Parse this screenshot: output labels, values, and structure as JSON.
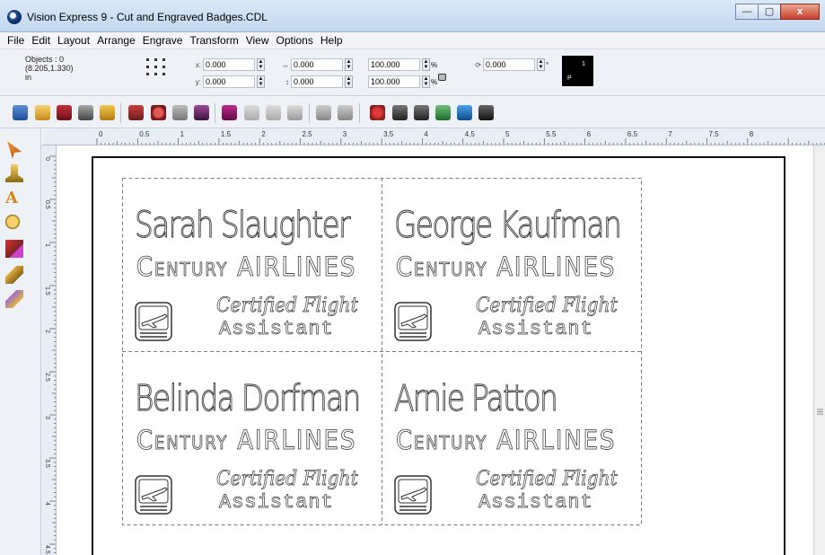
{
  "window": {
    "title": "Vision Express 9 - Cut and Engraved Badges.CDL",
    "buttons": {
      "minimize": "—",
      "maximize": "▢",
      "close": "x"
    }
  },
  "menu": [
    "File",
    "Edit",
    "Layout",
    "Arrange",
    "Engrave",
    "Transform",
    "View",
    "Options",
    "Help"
  ],
  "properties": {
    "objects_label": "Objects : 0",
    "position": "(8.205,1.330)",
    "units": "in",
    "x_label": "x:",
    "x": "0.000",
    "y_label": "y:",
    "y": "0.000",
    "width": "0.000",
    "height": "0.000",
    "scale_x": "100.000",
    "scale_y": "100.000",
    "rotation": "0.000",
    "degree": "°",
    "pct_symbol": "%",
    "swatch_number": "1",
    "swatch_letter": "P"
  },
  "ruler": {
    "horizontal": [
      "0",
      "0.5",
      "1",
      "1.5",
      "2",
      "2.5",
      "3",
      "3.5",
      "4",
      "4.5",
      "5",
      "5.5",
      "6",
      "6.5",
      "7",
      "7.5",
      "8"
    ],
    "vertical": [
      "0",
      "0.5",
      "1",
      "1.5",
      "2",
      "2.5",
      "3",
      "3.5",
      "4",
      "4.5"
    ]
  },
  "badges": [
    {
      "name": "Sarah Slaughter",
      "company": "Century AIRLINES",
      "title_line1": "Certified Flight",
      "title_line2": "Assistant"
    },
    {
      "name": "George Kaufman",
      "company": "Century AIRLINES",
      "title_line1": "Certified Flight",
      "title_line2": "Assistant"
    },
    {
      "name": "Belinda Dorfman",
      "company": "Century AIRLINES",
      "title_line1": "Certified Flight",
      "title_line2": "Assistant"
    },
    {
      "name": "Arnie Patton",
      "company": "Century AIRLINES",
      "title_line1": "Certified Flight",
      "title_line2": "Assistant"
    }
  ],
  "icons": {
    "toolbar": [
      "new-icon",
      "open-icon",
      "save-icon",
      "print-setup-icon",
      "print-icon",
      "engrave-icon",
      "undo-icon",
      "redo-icon",
      "import-icon",
      "export-icon",
      "weld-icon",
      "trim-icon",
      "outline-icon",
      "grid-icon",
      "align-icon",
      "star-icon",
      "node-edit-icon",
      "node-add-icon",
      "eraser-icon",
      "screen-icon",
      "move-icon"
    ],
    "tools": [
      "select-tool-icon",
      "fill-tool-icon",
      "text-tool-icon",
      "zoom-tool-icon",
      "shape-tool-icon",
      "pencil-tool-icon",
      "brush-tool-icon"
    ]
  },
  "colors": {
    "titlebar": "#c3d7ef",
    "chrome": "#eef1f6",
    "close_button": "#c7412b",
    "engraving_outline": "#333333",
    "cut_line": "#7a7a7a"
  }
}
